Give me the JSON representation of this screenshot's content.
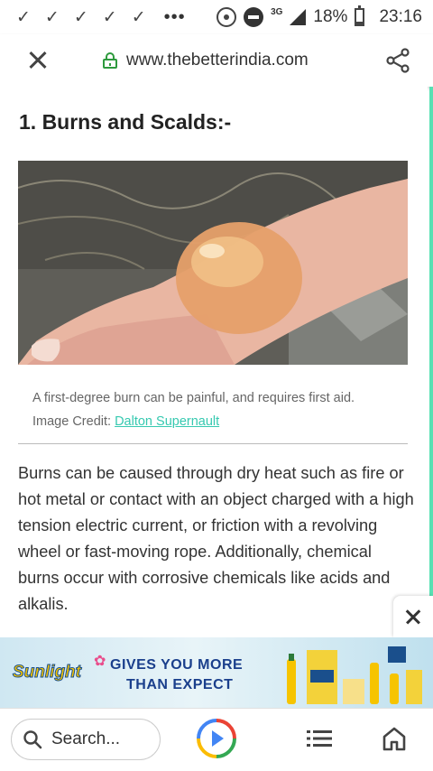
{
  "status_bar": {
    "notifications": [
      "✓",
      "✓",
      "✓",
      "✓",
      "✓"
    ],
    "more": "•••",
    "network": "3G",
    "battery": "18%",
    "battery_level": 0.18,
    "time": "23:16"
  },
  "browser": {
    "url": "www.thebetterindia.com",
    "close_icon": "close-icon",
    "share_icon": "share-icon",
    "lock_icon": "lock-icon"
  },
  "article": {
    "heading": "1. Burns and Scalds:-",
    "caption": "A first-degree burn can be painful, and requires first aid. Image Credit: ",
    "caption_link": "Dalton Supernault",
    "body": "Burns can be caused through dry heat such as fire or hot metal or contact with an object charged with a high tension electric current, or friction with a revolving wheel or fast-moving rope. Additionally, chemical burns occur with corrosive chemicals like acids and alkalis.",
    "accent_color": "#58e0b3",
    "link_color": "#36c9b0"
  },
  "ad": {
    "brand": "Sunlight",
    "headline_1": "GIVES YOU MORE",
    "headline_2": "THAN EXPECT",
    "close_icon": "close-icon"
  },
  "bottom_nav": {
    "search_placeholder": "Search...",
    "icons": [
      "search-icon",
      "play-icon",
      "tabs-icon",
      "home-icon"
    ]
  }
}
